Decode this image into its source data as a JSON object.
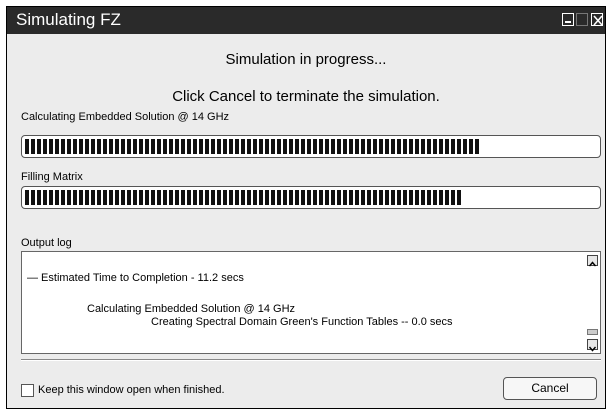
{
  "window": {
    "title": "Simulating FZ"
  },
  "headings": {
    "status": "Simulation in progress...",
    "instruction": "Click Cancel to terminate the simulation."
  },
  "progress": [
    {
      "label": "Calculating Embedded Solution @ 14 GHz",
      "fraction": 0.79
    },
    {
      "label": "Filling Matrix",
      "fraction": 0.76
    }
  ],
  "output_log": {
    "label": "Output log",
    "lines": [
      "— Estimated Time to Completion - 11.2 secs",
      "Calculating Embedded Solution @ 14 GHz",
      "Creating Spectral Domain Green's Function Tables -- 0.0 secs"
    ]
  },
  "footer": {
    "keep_open_label": "Keep this window open when finished.",
    "keep_open_checked": false,
    "cancel_label": "Cancel"
  },
  "icons": {
    "minimize": "minimize-icon",
    "maximize": "maximize-icon",
    "close": "close-icon",
    "scroll_up": "chevron-up-icon",
    "scroll_down": "chevron-down-icon"
  }
}
